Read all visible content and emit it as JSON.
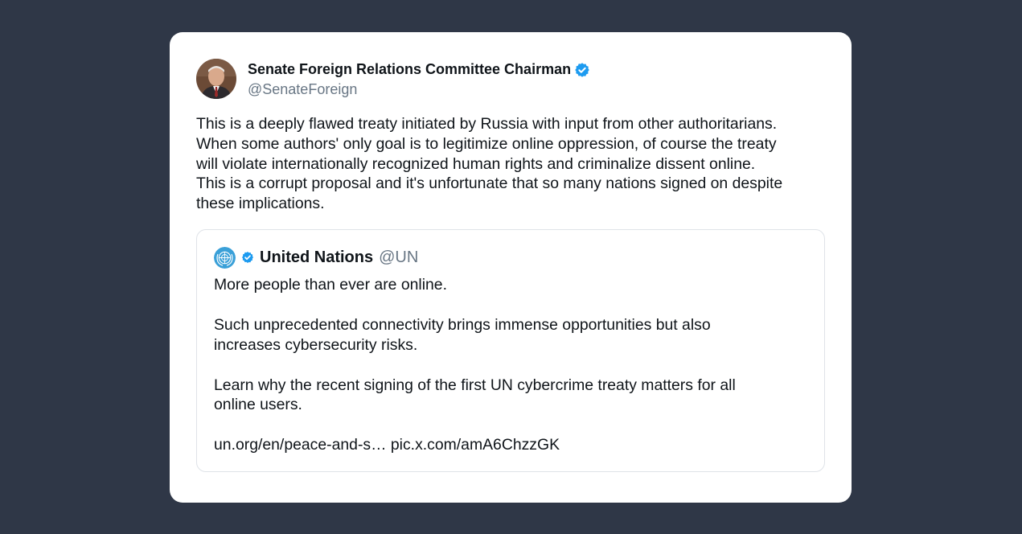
{
  "tweet": {
    "author": {
      "display_name": "Senate Foreign Relations Committee Chairman",
      "handle": "@SenateForeign",
      "verified": true,
      "avatar": "senator-portrait"
    },
    "text": "This is a deeply flawed treaty initiated by Russia with input from other authoritarians.\nWhen some authors' only goal is to legitimize online oppression, of course the treaty\nwill violate internationally recognized human rights and criminalize dissent online.\nThis is a corrupt proposal and it's unfortunate that so many nations signed on despite\nthese implications."
  },
  "quoted_tweet": {
    "author": {
      "display_name": "United Nations",
      "handle": "@UN",
      "verified": true,
      "avatar": "un-emblem"
    },
    "text": "More people than ever are online.\n\nSuch unprecedented connectivity brings immense opportunities but also\nincreases cybersecurity risks.\n\nLearn why the recent signing of the first UN cybercrime treaty matters for all\nonline users.\n\nun.org/en/peace-and-s… pic.x.com/amA6ChzzGK"
  },
  "colors": {
    "background": "#2f3747",
    "card": "#ffffff",
    "verified_badge": "#1d9bf0",
    "handle_text": "#687684",
    "un_blue": "#3aa0d8"
  }
}
